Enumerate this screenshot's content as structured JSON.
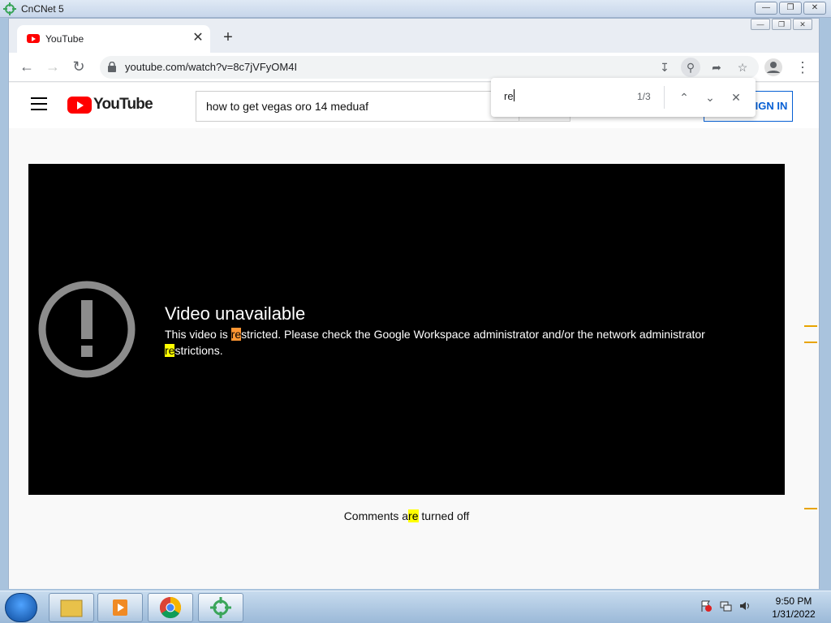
{
  "outer_window": {
    "title": "CnCNet 5"
  },
  "browser": {
    "tab": {
      "title": "YouTube"
    },
    "url": "youtube.com/watch?v=8c7jVFyOM4I"
  },
  "youtube": {
    "logo_text": "YouTube",
    "search_value": "how to get vegas oro 14 meduaf",
    "signin_label": "SIGN IN",
    "video_error": {
      "title": "Video unavailable",
      "text_before": "This video is ",
      "match1": "re",
      "text_middle": "stricted. Please check the Google Workspace administrator and/or the network administrator ",
      "match2": "re",
      "text_after": "strictions."
    },
    "comments": {
      "before": "Comments a",
      "match": "re",
      "after": " turned off"
    }
  },
  "find_bar": {
    "query": "re",
    "count": "1/3"
  },
  "taskbar": {
    "time": "9:50 PM",
    "date": "1/31/2022"
  },
  "colors": {
    "find_active": "#ff9632",
    "find_match": "#ffff00",
    "youtube_red": "#ff0000",
    "signin_blue": "#065fd4"
  }
}
